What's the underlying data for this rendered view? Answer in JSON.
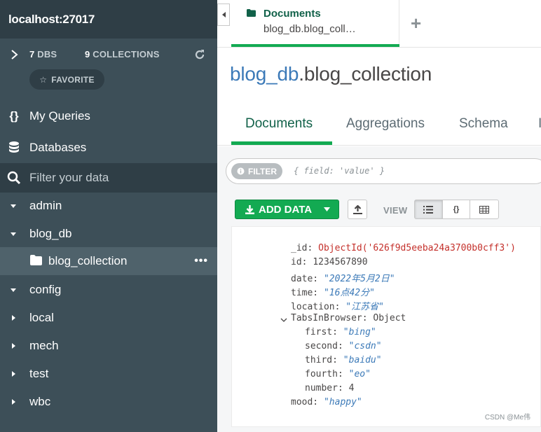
{
  "sidebar": {
    "host": "localhost:27017",
    "stats": {
      "dbs_count": "7",
      "dbs_label": "DBS",
      "collections_count": "9",
      "collections_label": "COLLECTIONS"
    },
    "favorite_label": "FAVORITE",
    "nav": {
      "my_queries": "My Queries",
      "databases": "Databases"
    },
    "filter_placeholder": "Filter your data",
    "databases": [
      {
        "name": "admin",
        "expanded": true
      },
      {
        "name": "blog_db",
        "expanded": true
      },
      {
        "name": "config",
        "expanded": true
      },
      {
        "name": "local",
        "expanded": false
      },
      {
        "name": "mech",
        "expanded": false
      },
      {
        "name": "test",
        "expanded": false
      },
      {
        "name": "wbc",
        "expanded": false
      }
    ],
    "selected_collection": "blog_collection",
    "more_label": "•••"
  },
  "tabs": {
    "active": {
      "title": "Documents",
      "subtitle": "blog_db.blog_coll…"
    },
    "add_label": "+"
  },
  "namespace": {
    "db": "blog_db",
    "collection": ".blog_collection"
  },
  "subtabs": [
    "Documents",
    "Aggregations",
    "Schema",
    "I"
  ],
  "filter": {
    "pill_label": "FILTER",
    "query_placeholder": "{ field: 'value' }"
  },
  "toolbar": {
    "add_data_label": "ADD DATA",
    "view_label": "VIEW",
    "view_modes": [
      "list",
      "json",
      "table"
    ],
    "active_view": "list"
  },
  "document": {
    "id_key": "_id:",
    "id_value": "ObjectId('626f9d5eeba24a3700b0cff3')",
    "fields": [
      {
        "key": "id:",
        "value": "1234567890",
        "type": "num"
      },
      {
        "key": "date:",
        "value": "\"2022年5月2日\"",
        "type": "str"
      },
      {
        "key": "time:",
        "value": "\"16点42分\"",
        "type": "str"
      },
      {
        "key": "location:",
        "value": "\"江苏省\"",
        "type": "str"
      }
    ],
    "nested_key": "TabsInBrowser:",
    "nested_type": "Object",
    "nested_fields": [
      {
        "key": "first:",
        "value": "\"bing\"",
        "type": "str"
      },
      {
        "key": "second:",
        "value": "\"csdn\"",
        "type": "str"
      },
      {
        "key": "third:",
        "value": "\"baidu\"",
        "type": "str"
      },
      {
        "key": "fourth:",
        "value": "\"eo\"",
        "type": "str"
      },
      {
        "key": "number:",
        "value": "4",
        "type": "num"
      }
    ],
    "last_field": {
      "key": "mood:",
      "value": "\"happy\"",
      "type": "str"
    }
  },
  "watermark": "CSDN @Me伟",
  "colors": {
    "sidebar": "#3d4f58",
    "sidebar_dark": "#2f3e46",
    "accent_green": "#13aa52",
    "dark_green": "#116149",
    "link_blue": "#3c7ab8",
    "oid_red": "#c4302b"
  }
}
